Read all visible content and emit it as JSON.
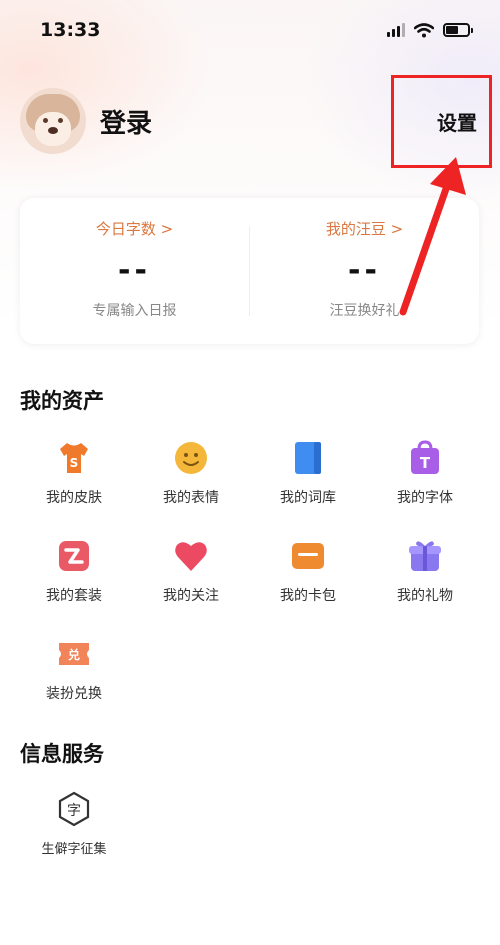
{
  "status_bar": {
    "time": "13:33"
  },
  "header": {
    "login_label": "登录",
    "settings_label": "设置"
  },
  "stats": [
    {
      "title": "今日字数 >",
      "value": "--",
      "subtitle": "专属输入日报"
    },
    {
      "title": "我的汪豆 >",
      "value": "--",
      "subtitle": "汪豆换好礼"
    }
  ],
  "assets": {
    "title": "我的资产",
    "items": [
      {
        "label": "我的皮肤",
        "icon": "tshirt-icon"
      },
      {
        "label": "我的表情",
        "icon": "smiley-icon"
      },
      {
        "label": "我的词库",
        "icon": "book-icon"
      },
      {
        "label": "我的字体",
        "icon": "font-bag-icon"
      },
      {
        "label": "我的套装",
        "icon": "suit-icon"
      },
      {
        "label": "我的关注",
        "icon": "heart-icon"
      },
      {
        "label": "我的卡包",
        "icon": "card-wallet-icon"
      },
      {
        "label": "我的礼物",
        "icon": "gift-icon"
      },
      {
        "label": "装扮兑换",
        "icon": "exchange-ticket-icon"
      }
    ]
  },
  "services": {
    "title": "信息服务",
    "items": [
      {
        "label": "生僻字征集",
        "icon": "rare-char-icon"
      }
    ]
  },
  "colors": {
    "accent_orange": "#d97840",
    "highlight_red": "#ee2323"
  }
}
